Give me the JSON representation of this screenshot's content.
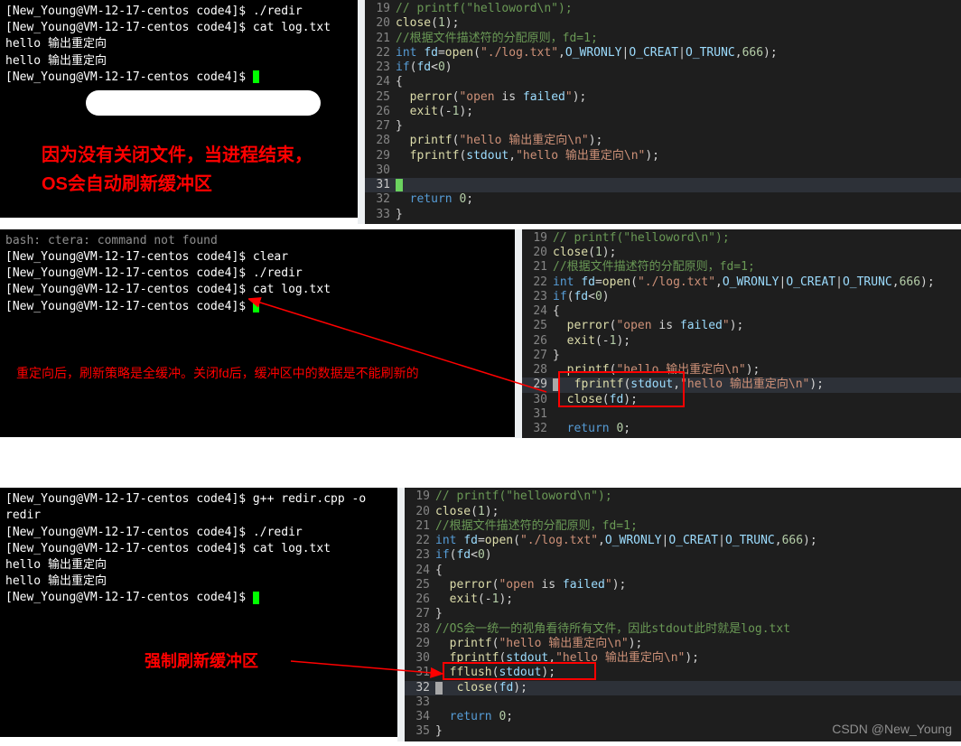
{
  "panel1": {
    "terminal": {
      "lines": [
        "[New_Young@VM-12-17-centos code4]$ ./redir",
        "[New_Young@VM-12-17-centos code4]$ cat log.txt",
        "hello 输出重定向",
        "hello 输出重定向",
        "[New_Young@VM-12-17-centos code4]$ "
      ],
      "annotation": "因为没有关闭文件，当进程结束，OS会自动刷新缓冲区"
    },
    "code": [
      {
        "n": 19,
        "t": "// printf(\"helloword\\n\");",
        "cls": "cm"
      },
      {
        "n": 20,
        "raw": [
          "fn:close",
          "pn:(",
          "nm:1",
          "pn:);"
        ]
      },
      {
        "n": 21,
        "t": "//根据文件描述符的分配原则，fd=1;",
        "cls": "cm"
      },
      {
        "n": 22,
        "raw": [
          "kw:int ",
          "id:fd",
          "pn:=",
          "fn:open",
          "pn:(",
          "st:\"./log.txt\"",
          "pn:,",
          "id:O_WRONLY",
          "pn:|",
          "id:O_CREAT",
          "pn:|",
          "id:O_TRUNC",
          "pn:,",
          "nm:666",
          "pn:);"
        ]
      },
      {
        "n": 23,
        "raw": [
          "kw:if",
          "pn:(",
          "id:fd",
          "pn:<",
          "nm:0",
          "pn:)"
        ]
      },
      {
        "n": 24,
        "t": "{",
        "cls": "pn"
      },
      {
        "n": 25,
        "raw": [
          "pn:  ",
          "fn:perror",
          "pn:(",
          "st:\"open",
          "pn: is ",
          "id:failed",
          "st:\"",
          "pn:);"
        ]
      },
      {
        "n": 26,
        "raw": [
          "pn:  ",
          "fn:exit",
          "pn:(-",
          "nm:1",
          "pn:);"
        ]
      },
      {
        "n": 27,
        "t": "}",
        "cls": "pn"
      },
      {
        "n": 28,
        "raw": [
          "pn:  ",
          "fn:printf",
          "pn:(",
          "st:\"hello 输出重定向\\n\"",
          "pn:);"
        ]
      },
      {
        "n": 29,
        "raw": [
          "pn:  ",
          "fn:fprintf",
          "pn:(",
          "id:stdout",
          "pn:,",
          "st:\"hello 输出重定向\\n\"",
          "pn:);"
        ]
      },
      {
        "n": 30,
        "t": "",
        "cls": "pn"
      },
      {
        "n": 31,
        "t": "",
        "cls": "pn",
        "hl": true,
        "cursor": "g"
      },
      {
        "n": 32,
        "raw": [
          "pn:  ",
          "kw:return ",
          "nm:0",
          "pn:;"
        ]
      },
      {
        "n": 33,
        "t": "}",
        "cls": "pn"
      }
    ]
  },
  "panel2": {
    "terminal": {
      "lines": [
        "bash: ctera: command not found",
        "[New_Young@VM-12-17-centos code4]$ clear",
        "[New_Young@VM-12-17-centos code4]$ ./redir",
        "[New_Young@VM-12-17-centos code4]$ cat log.txt",
        "[New_Young@VM-12-17-centos code4]$ "
      ],
      "annotation": "重定向后，刷新策略是全缓冲。关闭fd后，缓冲区中的数据是不能刷新的"
    },
    "code": [
      {
        "n": 19,
        "t": "// printf(\"helloword\\n\");",
        "cls": "cm"
      },
      {
        "n": 20,
        "raw": [
          "fn:close",
          "pn:(",
          "nm:1",
          "pn:);"
        ]
      },
      {
        "n": 21,
        "t": "//根据文件描述符的分配原则，fd=1;",
        "cls": "cm"
      },
      {
        "n": 22,
        "raw": [
          "kw:int ",
          "id:fd",
          "pn:=",
          "fn:open",
          "pn:(",
          "st:\"./log.txt\"",
          "pn:,",
          "id:O_WRONLY",
          "pn:|",
          "id:O_CREAT",
          "pn:|",
          "id:O_TRUNC",
          "pn:,",
          "nm:666",
          "pn:);"
        ]
      },
      {
        "n": 23,
        "raw": [
          "kw:if",
          "pn:(",
          "id:fd",
          "pn:<",
          "nm:0",
          "pn:)"
        ]
      },
      {
        "n": 24,
        "t": "{",
        "cls": "pn"
      },
      {
        "n": 25,
        "raw": [
          "pn:  ",
          "fn:perror",
          "pn:(",
          "st:\"open",
          "pn: is ",
          "id:failed",
          "st:\"",
          "pn:);"
        ]
      },
      {
        "n": 26,
        "raw": [
          "pn:  ",
          "fn:exit",
          "pn:(-",
          "nm:1",
          "pn:);"
        ]
      },
      {
        "n": 27,
        "t": "}",
        "cls": "pn"
      },
      {
        "n": 28,
        "raw": [
          "pn:  ",
          "fn:printf",
          "pn:(",
          "st:\"hello 输出重定向\\n\"",
          "pn:);"
        ]
      },
      {
        "n": 29,
        "raw": [
          "pn:  ",
          "fn:fprintf",
          "pn:(",
          "id:stdout",
          "pn:,",
          "st:\"hello 输出重定向\\n\"",
          "pn:);"
        ],
        "hl": true,
        "cursor": "w"
      },
      {
        "n": 30,
        "raw": [
          "pn:  ",
          "fn:close",
          "pn:(",
          "id:fd",
          "pn:);"
        ]
      },
      {
        "n": 31,
        "t": "",
        "cls": "pn"
      },
      {
        "n": 32,
        "raw": [
          "pn:  ",
          "kw:return ",
          "nm:0",
          "pn:;"
        ]
      }
    ]
  },
  "panel3": {
    "terminal": {
      "lines": [
        "[New_Young@VM-12-17-centos code4]$ g++ redir.cpp -o redir",
        "[New_Young@VM-12-17-centos code4]$ ./redir",
        "[New_Young@VM-12-17-centos code4]$ cat log.txt",
        "hello 输出重定向",
        "hello 输出重定向",
        "[New_Young@VM-12-17-centos code4]$ "
      ],
      "annotation": "强制刷新缓冲区"
    },
    "code": [
      {
        "n": 19,
        "t": "// printf(\"helloword\\n\");",
        "cls": "cm"
      },
      {
        "n": 20,
        "raw": [
          "fn:close",
          "pn:(",
          "nm:1",
          "pn:);"
        ]
      },
      {
        "n": 21,
        "t": "//根据文件描述符的分配原则，fd=1;",
        "cls": "cm"
      },
      {
        "n": 22,
        "raw": [
          "kw:int ",
          "id:fd",
          "pn:=",
          "fn:open",
          "pn:(",
          "st:\"./log.txt\"",
          "pn:,",
          "id:O_WRONLY",
          "pn:|",
          "id:O_CREAT",
          "pn:|",
          "id:O_TRUNC",
          "pn:,",
          "nm:666",
          "pn:);"
        ]
      },
      {
        "n": 23,
        "raw": [
          "kw:if",
          "pn:(",
          "id:fd",
          "pn:<",
          "nm:0",
          "pn:)"
        ]
      },
      {
        "n": 24,
        "t": "{",
        "cls": "pn"
      },
      {
        "n": 25,
        "raw": [
          "pn:  ",
          "fn:perror",
          "pn:(",
          "st:\"open",
          "pn: is ",
          "id:failed",
          "st:\"",
          "pn:);"
        ]
      },
      {
        "n": 26,
        "raw": [
          "pn:  ",
          "fn:exit",
          "pn:(-",
          "nm:1",
          "pn:);"
        ]
      },
      {
        "n": 27,
        "t": "}",
        "cls": "pn"
      },
      {
        "n": 28,
        "t": "//OS会一统一的视角看待所有文件，因此stdout此时就是log.txt",
        "cls": "cm"
      },
      {
        "n": 29,
        "raw": [
          "pn:  ",
          "fn:printf",
          "pn:(",
          "st:\"hello 输出重定向\\n\"",
          "pn:);"
        ]
      },
      {
        "n": 30,
        "raw": [
          "pn:  ",
          "fn:fprintf",
          "pn:(",
          "id:stdout",
          "pn:,",
          "st:\"hello 输出重定向\\n\"",
          "pn:);"
        ]
      },
      {
        "n": 31,
        "raw": [
          "pn:  ",
          "fn:fflush",
          "pn:(",
          "id:stdout",
          "pn:);"
        ]
      },
      {
        "n": 32,
        "raw": [
          "pn:  ",
          "fn:close",
          "pn:(",
          "id:fd",
          "pn:);"
        ],
        "hl": true,
        "cursor": "w"
      },
      {
        "n": 33,
        "t": "",
        "cls": "pn"
      },
      {
        "n": 34,
        "raw": [
          "pn:  ",
          "kw:return ",
          "nm:0",
          "pn:;"
        ]
      },
      {
        "n": 35,
        "t": "}",
        "cls": "pn"
      }
    ]
  },
  "watermark": "CSDN @New_Young"
}
